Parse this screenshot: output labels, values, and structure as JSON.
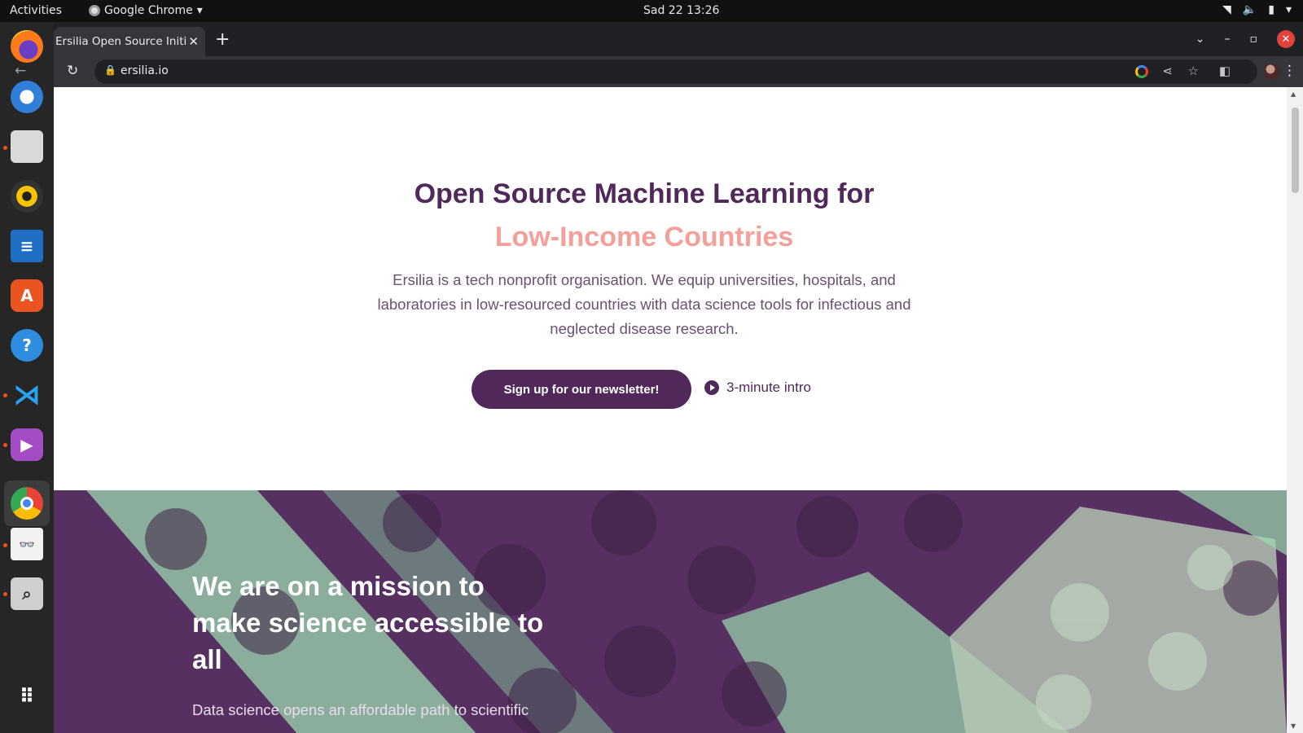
{
  "topbar": {
    "activities": "Activities",
    "app_name": "Google Chrome",
    "clock": "Sad 22  13:26"
  },
  "dock": {
    "items": [
      "firefox-icon",
      "thunderbird-icon",
      "files-icon",
      "rhythmbox-icon",
      "writer-icon",
      "software-icon",
      "help-icon",
      "vscode-icon",
      "media-player-icon",
      "chrome-icon",
      "text-editor-icon",
      "screenshot-icon",
      "app-grid-icon"
    ]
  },
  "browser": {
    "tab_title": "Ersilia Open Source Initiative",
    "url": "ersilia.io"
  },
  "hero": {
    "title": "Open Source Machine Learning for",
    "subtitle": "Low-Income Countries",
    "description": "Ersilia is a tech nonprofit organisation. We equip universities, hospitals, and laboratories in low-resourced countries with data science tools for infectious and neglected disease research.",
    "newsletter_button": "Sign up for our newsletter!",
    "intro_link": "3-minute intro"
  },
  "mission": {
    "title": "We are on a mission to make science accessible to all",
    "text": "Data science opens an affordable path to scientific"
  },
  "colors": {
    "brand_purple": "#50285a",
    "accent_pink": "#f4a09a",
    "mint": "#9ed8b0"
  }
}
